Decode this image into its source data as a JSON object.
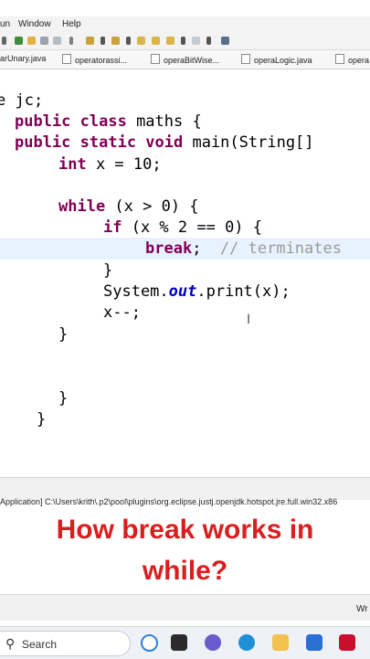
{
  "menu": {
    "items": [
      "un",
      "Window",
      "Help"
    ]
  },
  "tabs": [
    "arUnary.java",
    "operatorassi...",
    "operaBitWise...",
    "operaLogic.java",
    "opera"
  ],
  "code": {
    "l1_plain": "e jc;",
    "l2_kw": "public class",
    "l2_rest": " maths {",
    "l3_kw": "public static void",
    "l3_rest": " main(String[]",
    "l4_kw": "int",
    "l4_rest": " x = 10;",
    "l6_kw": "while",
    "l6_rest": " (x > 0) {",
    "l7_kw": "if",
    "l7_rest": " (x % 2 == 0) {",
    "l8_kw": "break",
    "l8_semi": ";",
    "l8_cmt": "// terminates",
    "l9_text": "}",
    "l10_a": "System.",
    "l10_field": "out",
    "l10_b": ".print(x);",
    "l11_text": "x--;",
    "l12_text": "}",
    "l15_text": "}",
    "l16_text": "}"
  },
  "console": {
    "path": "Application] C:\\Users\\krith\\.p2\\pool\\plugins\\org.eclipse.justj.openjdk.hotspot.jre.full.win32.x86"
  },
  "caption": {
    "line1": "How break works in",
    "line2": "while?"
  },
  "status": {
    "right": "Wr"
  },
  "taskbar": {
    "search_placeholder": "Search"
  },
  "colors": {
    "keyword": "#7f0055",
    "field": "#0000c0",
    "comment": "#9a9a9a",
    "caption": "#d91e1e",
    "line_highlight": "#e8f2fe"
  }
}
